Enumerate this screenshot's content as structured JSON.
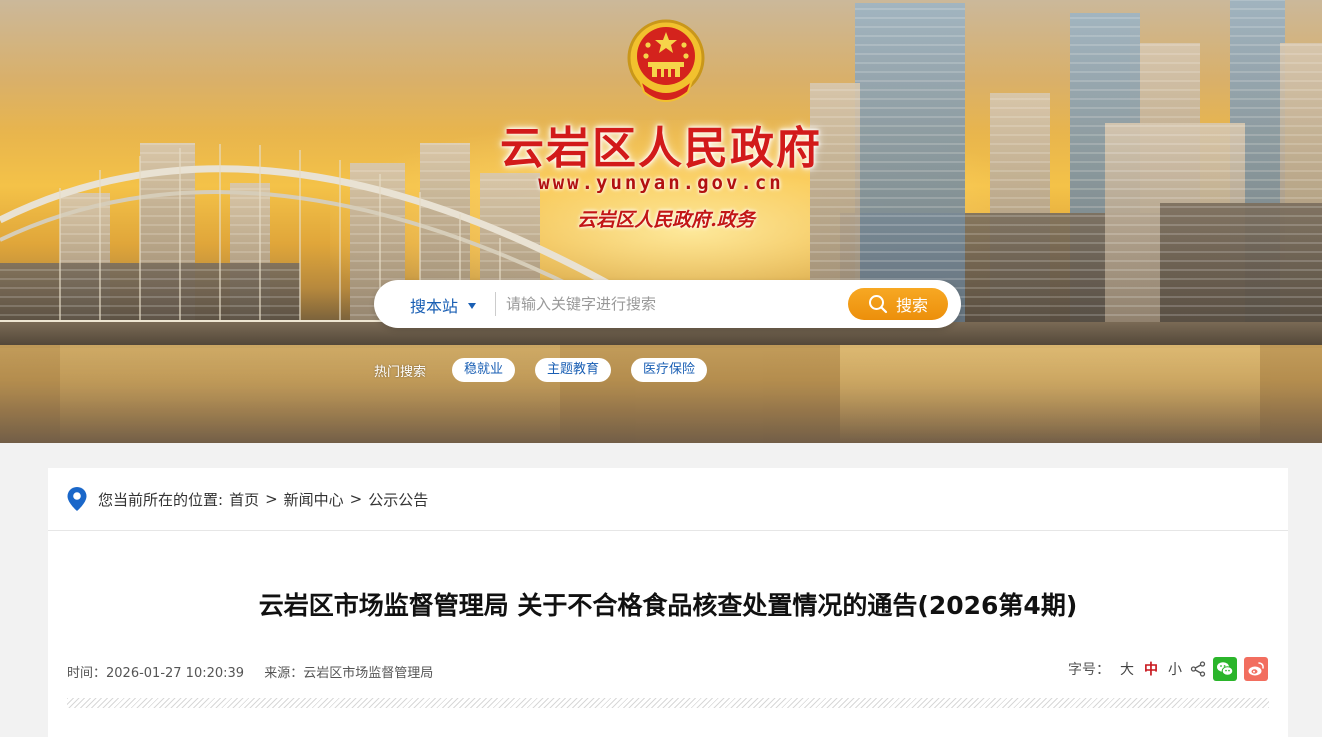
{
  "banner": {
    "site_title": "云岩区人民政府",
    "site_url": "www.yunyan.gov.cn",
    "site_subtitle": "云岩区人民政府.政务",
    "emblem_icon": "national-emblem-icon"
  },
  "search": {
    "scope_label": "搜本站",
    "placeholder": "请输入关键字进行搜索",
    "button_label": "搜索"
  },
  "hot_search": {
    "label": "热门搜索",
    "tags": [
      "稳就业",
      "主题教育",
      "医疗保险"
    ]
  },
  "breadcrumb": {
    "prefix": "您当前所在的位置:",
    "items": [
      "首页",
      "新闻中心",
      "公示公告"
    ],
    "separator": ">"
  },
  "article": {
    "title": "云岩区市场监督管理局 关于不合格食品核查处置情况的通告(2026第4期)",
    "time": "时间：2026-01-27 10:20:39",
    "source": "来源：云岩区市场监督管理局"
  },
  "tools": {
    "font_size_label": "字号：",
    "sizes": [
      "大",
      "中",
      "小"
    ],
    "active_size": "中"
  },
  "colors": {
    "title_red": "#d21a1a",
    "link_blue": "#1a5fb4",
    "search_orange": "#ec8f0b",
    "wechat_green": "#2bb52b",
    "weibo_red": "#f26e5f"
  }
}
